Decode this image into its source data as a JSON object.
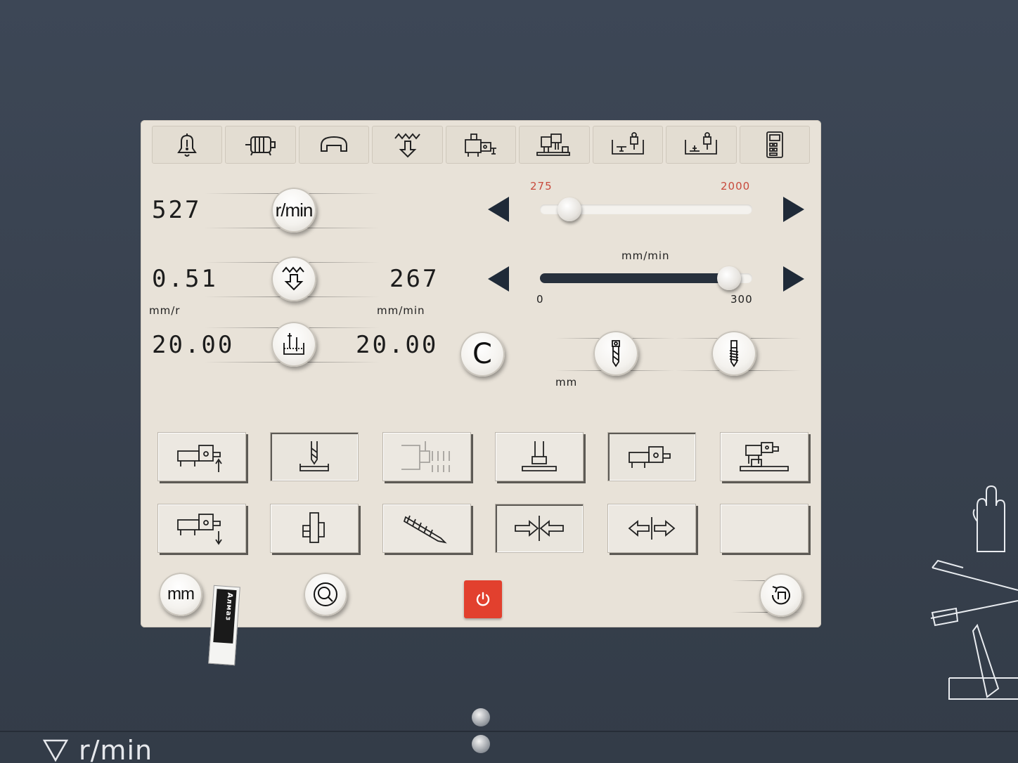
{
  "top_tabs": [
    {
      "icon": "alarm-bell-icon"
    },
    {
      "icon": "motor-icon"
    },
    {
      "icon": "coolant-icon"
    },
    {
      "icon": "feed-down-icon"
    },
    {
      "icon": "machine-tool-icon"
    },
    {
      "icon": "milling-machine-icon"
    },
    {
      "icon": "table-left-icon"
    },
    {
      "icon": "table-right-icon"
    },
    {
      "icon": "calculator-icon"
    }
  ],
  "spindle": {
    "value": "527",
    "knob_label": "r/min",
    "slider_min": "275",
    "slider_max": "2000",
    "slider_fraction": 0.14
  },
  "feed": {
    "value_mm_r": "0.51",
    "unit_mm_r": "mm/r",
    "value_mm_min": "267",
    "unit_mm_min": "mm/min",
    "slider_unit": "mm/min",
    "slider_min": "0",
    "slider_max": "300",
    "slider_fraction": 0.89
  },
  "depth": {
    "value_left": "20.00",
    "value_right": "20.00",
    "clear_label": "C",
    "unit": "mm"
  },
  "function_buttons": [
    {
      "name": "traverse-up-button",
      "icon": "traverse-up-icon",
      "active": false,
      "faded": false
    },
    {
      "name": "drill-mode-button",
      "icon": "drill-mode-icon",
      "active": true,
      "faded": false
    },
    {
      "name": "tapping-mode-button",
      "icon": "tapping-mode-icon",
      "active": false,
      "faded": true
    },
    {
      "name": "spindle-stop-button",
      "icon": "spindle-stop-icon",
      "active": false,
      "faded": false
    },
    {
      "name": "head-position-button",
      "icon": "head-position-icon",
      "active": true,
      "faded": false
    },
    {
      "name": "table-set-button",
      "icon": "table-set-icon",
      "active": false,
      "faded": false
    },
    {
      "name": "traverse-down-button",
      "icon": "traverse-down-icon",
      "active": false,
      "faded": false
    },
    {
      "name": "clamp-button",
      "icon": "clamp-icon",
      "active": false,
      "faded": false
    },
    {
      "name": "thread-button",
      "icon": "thread-icon",
      "active": false,
      "faded": false
    },
    {
      "name": "centering-in-button",
      "icon": "centering-in-icon",
      "active": true,
      "faded": false
    },
    {
      "name": "centering-out-button",
      "icon": "centering-out-icon",
      "active": false,
      "faded": false
    },
    {
      "name": "empty-button",
      "icon": "",
      "active": false,
      "faded": false
    }
  ],
  "footer": {
    "unit_button": "mm",
    "sticker_text": "Алмаз",
    "power_icon": "power-icon"
  },
  "housing": {
    "bottom_label": "r/min"
  },
  "colors": {
    "panel": "#e8e2d8",
    "housing": "#3a4452",
    "arrow": "#1f2a38",
    "power": "#e2402e",
    "range_red": "#c84a3c"
  }
}
